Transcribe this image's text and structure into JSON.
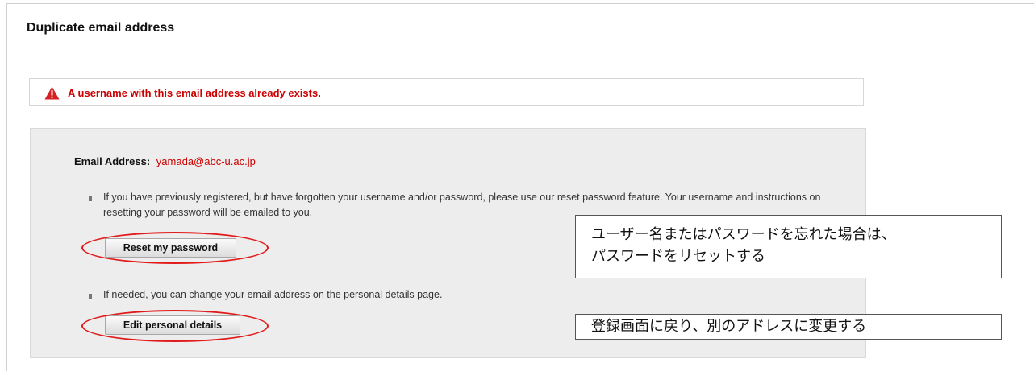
{
  "page": {
    "title": "Duplicate email address"
  },
  "alert": {
    "icon": "warning-triangle-icon",
    "message": "A username with this email address already exists.",
    "color": "#cc0000"
  },
  "details": {
    "email_label": "Email Address:",
    "email_value": "yamada@abc-u.ac.jp",
    "reset_text": "If you have previously registered, but have forgotten your username and/or password, please use our reset password feature. Your username and instructions on resetting your password will be emailed to you.",
    "reset_button": "Reset my password",
    "edit_text": "If needed, you can change your email address on the personal details page.",
    "edit_button": "Edit personal details"
  },
  "annotations": {
    "highlight_color": "#e11b1b",
    "reset_note_line1": "ユーザー名またはパスワードを忘れた場合は、",
    "reset_note_line2": "パスワードをリセットする",
    "edit_note": "登録画面に戻り、別のアドレスに変更する"
  }
}
